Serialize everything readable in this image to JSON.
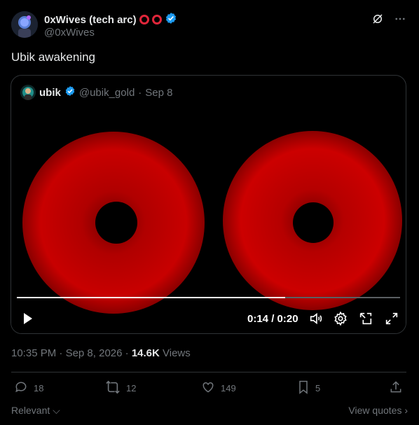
{
  "author": {
    "name": "0xWives (tech arc)",
    "handle": "@0xWives",
    "ring_color": "#e0263a",
    "verified_color": "#1d9bf0"
  },
  "tweet": {
    "text": "Ubik awakening"
  },
  "quote": {
    "name": "ubik",
    "handle": "@ubik_gold",
    "separator": "·",
    "date": "Sep 8"
  },
  "video": {
    "current_time": "0:14",
    "duration": "0:20",
    "time_display": "0:14 / 0:20",
    "progress": 0.7,
    "disc_color": "#c70000"
  },
  "meta": {
    "time": "10:35 PM",
    "date": "Sep 8, 2026",
    "separator": "·",
    "views_count": "14.6K",
    "views_label": "Views"
  },
  "actions": {
    "replies": "18",
    "reposts": "12",
    "likes": "149",
    "bookmarks": "5"
  },
  "footer": {
    "relevant": "Relevant",
    "view_quotes": "View quotes"
  },
  "icons": {
    "verified": "verified-badge-icon",
    "grok": "grok-icon",
    "more": "more-icon",
    "play": "play-icon",
    "volume": "volume-icon",
    "settings": "settings-icon",
    "pip": "picture-in-picture-icon",
    "fullscreen": "fullscreen-icon",
    "reply": "reply-icon",
    "repost": "repost-icon",
    "like": "like-icon",
    "bookmark": "bookmark-icon",
    "share": "share-icon"
  }
}
